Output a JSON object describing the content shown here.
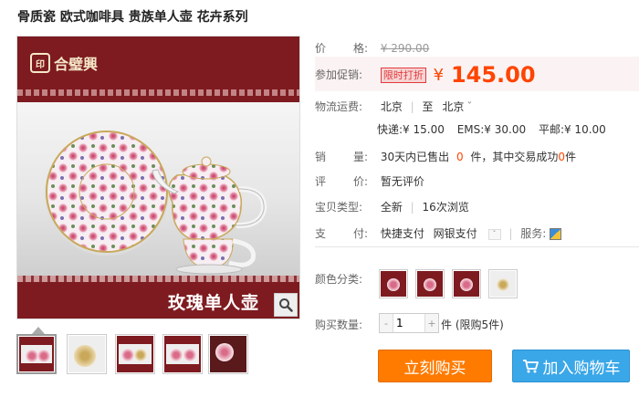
{
  "product": {
    "title": "骨质瓷 欧式咖啡具 贵族单人壶 花卉系列"
  },
  "main_image": {
    "logo_text": "合璧興",
    "caption": "玫瑰单人壶",
    "zoom_icon": "magnifier-icon"
  },
  "thumbnails": [
    {
      "name": "thumb-1"
    },
    {
      "name": "thumb-2"
    },
    {
      "name": "thumb-3"
    },
    {
      "name": "thumb-4"
    },
    {
      "name": "thumb-5"
    }
  ],
  "price": {
    "label": "价      格:",
    "original": "¥ 290.00"
  },
  "promo": {
    "label": "参加促销:",
    "badge": "限时打折",
    "currency": "¥",
    "value": "145.00"
  },
  "shipping": {
    "label": "物流运费:",
    "from": "北京",
    "sep": "|",
    "to_prefix": "至",
    "to": "北京",
    "dropdown_mark": "ˇ",
    "express_label": "快递:",
    "express": "¥ 15.00",
    "ems_label": "EMS:",
    "ems": "¥ 30.00",
    "mail_label": "平邮:",
    "mail": "¥ 10.00"
  },
  "sales": {
    "label": "销      量:",
    "prefix": "30天内已售出",
    "sold": "0",
    "middle": "件，其中交易成功",
    "success": "0",
    "suffix": "件"
  },
  "review": {
    "label": "评      价:",
    "value": "暂无评价"
  },
  "item_type": {
    "label": "宝贝类型:",
    "condition": "全新",
    "views": "16次浏览"
  },
  "payment": {
    "label": "支      付:",
    "method1": "快捷支付",
    "method2": "网银支付",
    "service_label": "服务:"
  },
  "color": {
    "label": "颜色分类:"
  },
  "quantity": {
    "label": "购买数量:",
    "minus": "-",
    "value": "1",
    "plus": "+",
    "unit_note": "件 (限购5件)"
  },
  "buttons": {
    "buy": "立刻购买",
    "cart": "加入购物车"
  },
  "colors": {
    "accent": "#ff4400",
    "buy_bg": "#ff7b00",
    "cart_bg": "#3aa7e8",
    "brand_red": "#7e1b20"
  }
}
